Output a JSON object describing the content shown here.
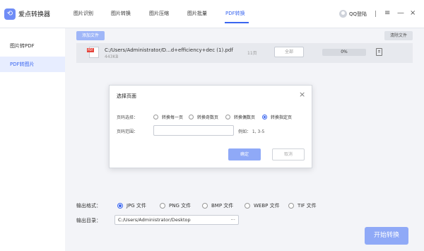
{
  "app": {
    "title": "爱点转换器"
  },
  "nav": {
    "tabs": [
      {
        "label": "图片识别"
      },
      {
        "label": "图片转换"
      },
      {
        "label": "图片压缩"
      },
      {
        "label": "图片批量"
      },
      {
        "label": "PDF转换"
      }
    ],
    "active": "PDF转换"
  },
  "header": {
    "login_label": "QQ登陆",
    "minimize": "—",
    "close": "×"
  },
  "sidebar": {
    "items": [
      {
        "label": "图片转PDF"
      },
      {
        "label": "PDF转图片"
      }
    ],
    "active": "PDF转图片"
  },
  "toolbar": {
    "add_label": "添加文件",
    "clear_label": "清除文件"
  },
  "file": {
    "icon_tag": "PDF",
    "name": "C:/Users/Administrator/D...d+efficiency+dec (1).pdf",
    "size": "443KB",
    "pages": "11页",
    "page_select": "全部",
    "progress_text": "0%",
    "progress_value": 0
  },
  "dialog": {
    "title": "选择页面",
    "close": "×",
    "page_select_label": "页码选择：",
    "options": [
      {
        "label": "转换每一页",
        "checked": false
      },
      {
        "label": "转换奇数页",
        "checked": false
      },
      {
        "label": "转换偶数页",
        "checked": false
      },
      {
        "label": "转换指定页",
        "checked": true
      }
    ],
    "range_label": "页码范围：",
    "range_value": "",
    "range_example": "例如： 1, 3-5",
    "ok_label": "确定",
    "cancel_label": "取消"
  },
  "output": {
    "format_label": "输出格式：",
    "formats": [
      {
        "label": "JPG 文件",
        "checked": true
      },
      {
        "label": "PNG 文件",
        "checked": false
      },
      {
        "label": "BMP 文件",
        "checked": false
      },
      {
        "label": "WEBP 文件",
        "checked": false
      },
      {
        "label": "TIF 文件",
        "checked": false
      }
    ],
    "dir_label": "输出目录：",
    "dir_value": "C:/Users/Administrator/Desktop",
    "dir_more": "···"
  },
  "start_label": "开始转换",
  "colors": {
    "accent": "#3a66f0",
    "button": "#8fa9f7",
    "pdf_red": "#e5443b"
  }
}
